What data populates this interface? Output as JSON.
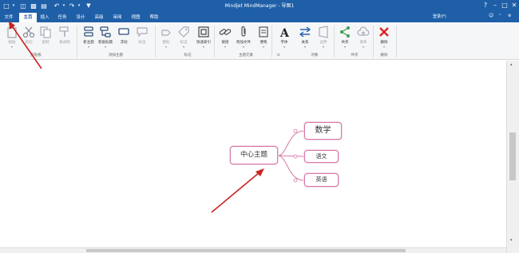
{
  "window": {
    "title": "Mindjet MindManager - 导图1"
  },
  "tabs": [
    {
      "label": "文件",
      "active": false
    },
    {
      "label": "主页",
      "active": true
    },
    {
      "label": "插入",
      "active": false
    },
    {
      "label": "任务",
      "active": false
    },
    {
      "label": "设计",
      "active": false
    },
    {
      "label": "高级",
      "active": false
    },
    {
      "label": "审阅",
      "active": false
    },
    {
      "label": "视图",
      "active": false
    },
    {
      "label": "帮助",
      "active": false
    }
  ],
  "signin": "登录(F)",
  "ribbon": {
    "groups": [
      {
        "label": "剪贴板",
        "buttons": [
          "粘贴",
          "剪切",
          "复制",
          "格式刷"
        ]
      },
      {
        "label": "添加主题",
        "buttons": [
          "新主题",
          "新副标题",
          "浮动",
          "标注"
        ]
      },
      {
        "label": "标记",
        "buttons": [
          "图标",
          "标记",
          "快速索引"
        ]
      },
      {
        "label": "主题元素",
        "buttons": [
          "链接",
          "附加文件",
          "便笺"
        ]
      },
      {
        "label": "对象",
        "buttons": [
          "字体",
          "关系",
          "边界"
        ]
      },
      {
        "label": "共享",
        "buttons": [
          "共享",
          "发布"
        ]
      },
      {
        "label": "删除",
        "buttons": [
          "删除"
        ]
      }
    ]
  },
  "map": {
    "central": "中心主题",
    "subtopics": [
      "数学",
      "语文",
      "英语"
    ]
  },
  "colors": {
    "titlebar": "#1e5fa8",
    "topic_border": "#d77aa8",
    "annotation_arrow": "#cc2222"
  }
}
